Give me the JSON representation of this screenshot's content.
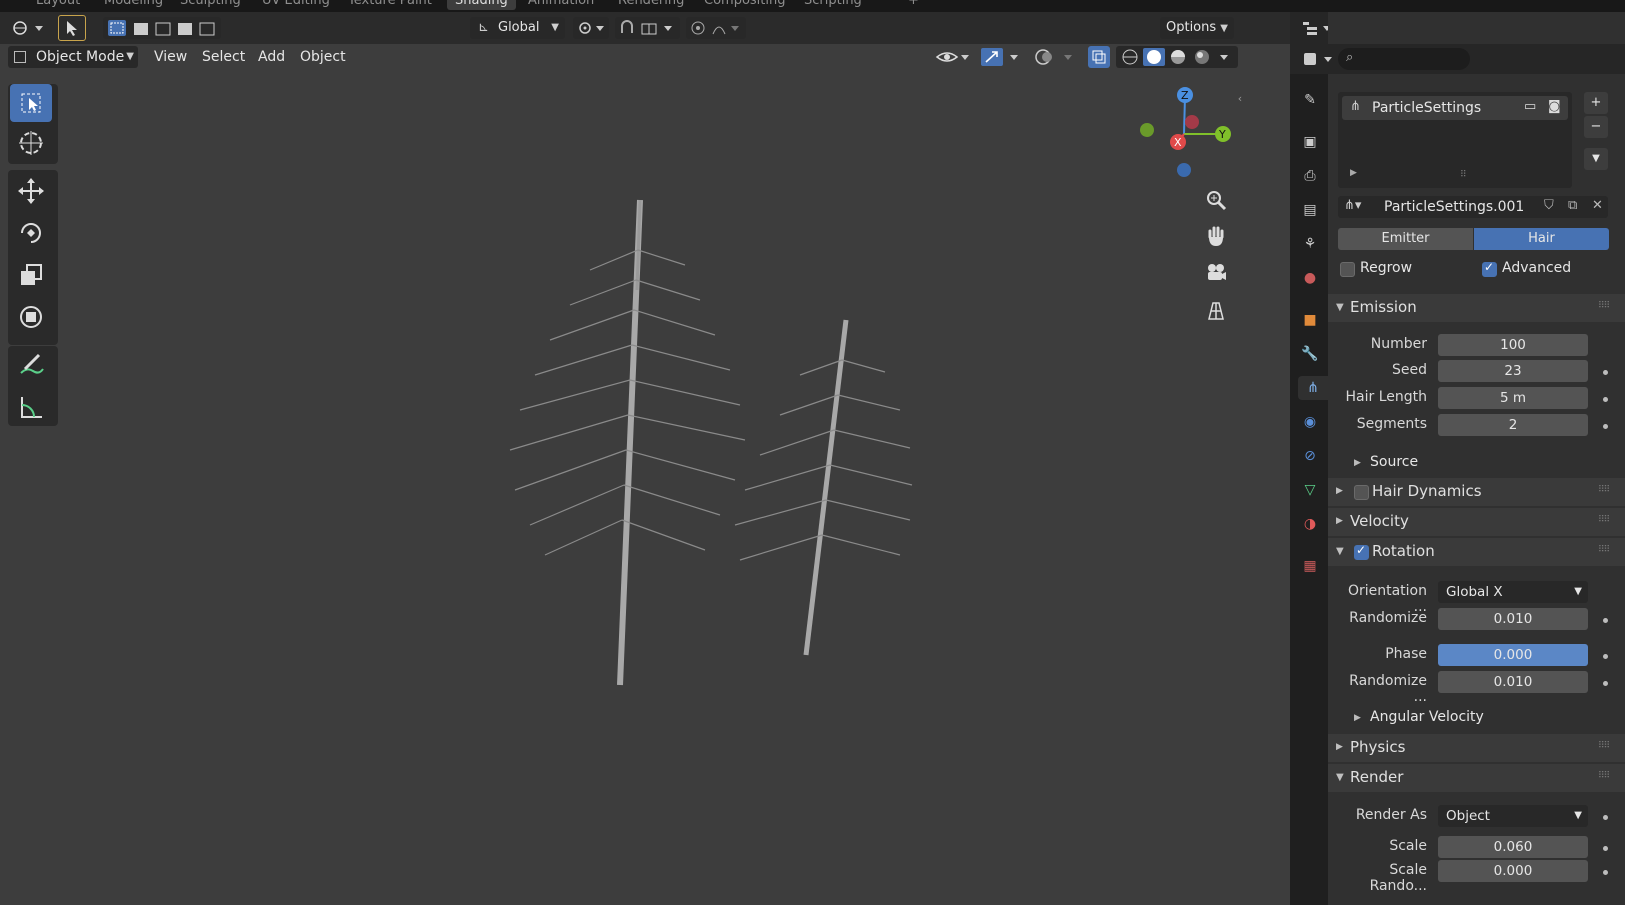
{
  "workspaces": [
    "Layout",
    "Modeling",
    "Sculpting",
    "UV Editing",
    "Texture Paint",
    "Shading",
    "Animation",
    "Rendering",
    "Compositing",
    "Scripting",
    "+"
  ],
  "active_workspace": "Shading",
  "viewport": {
    "transform_orientation": "Global",
    "options_label": "Options",
    "mode_label": "Object Mode",
    "menus": [
      "View",
      "Select",
      "Add",
      "Object"
    ]
  },
  "gizmo": {
    "z": "Z",
    "y": "Y",
    "x": "X"
  },
  "properties": {
    "material_slot": "ParticleSettings",
    "datablock_name": "ParticleSettings.001",
    "type_tabs": [
      "Emitter",
      "Hair"
    ],
    "active_type": "Hair",
    "regrow_label": "Regrow",
    "advanced_label": "Advanced",
    "emission": {
      "title": "Emission",
      "number_label": "Number",
      "number": "100",
      "seed_label": "Seed",
      "seed": "23",
      "hair_length_label": "Hair Length",
      "hair_length": "5 m",
      "segments_label": "Segments",
      "segments": "2",
      "source_label": "Source"
    },
    "hair_dynamics": "Hair Dynamics",
    "velocity": "Velocity",
    "rotation": {
      "title": "Rotation",
      "orientation_label": "Orientation ...",
      "orientation": "Global X",
      "randomize_label": "Randomize",
      "randomize": "0.010",
      "phase_label": "Phase",
      "phase": "0.000",
      "randomize_phase_label": "Randomize ...",
      "randomize_phase": "0.010",
      "angular_velocity": "Angular Velocity"
    },
    "physics": "Physics",
    "render": {
      "title": "Render",
      "render_as_label": "Render As",
      "render_as": "Object",
      "scale_label": "Scale",
      "scale": "0.060",
      "scale_random_label": "Scale Rando...",
      "scale_random": "0.000"
    }
  },
  "colors": {
    "accent": "#4772b3",
    "viewport_bg": "#3d3d3d",
    "panel_bg": "#303030"
  }
}
